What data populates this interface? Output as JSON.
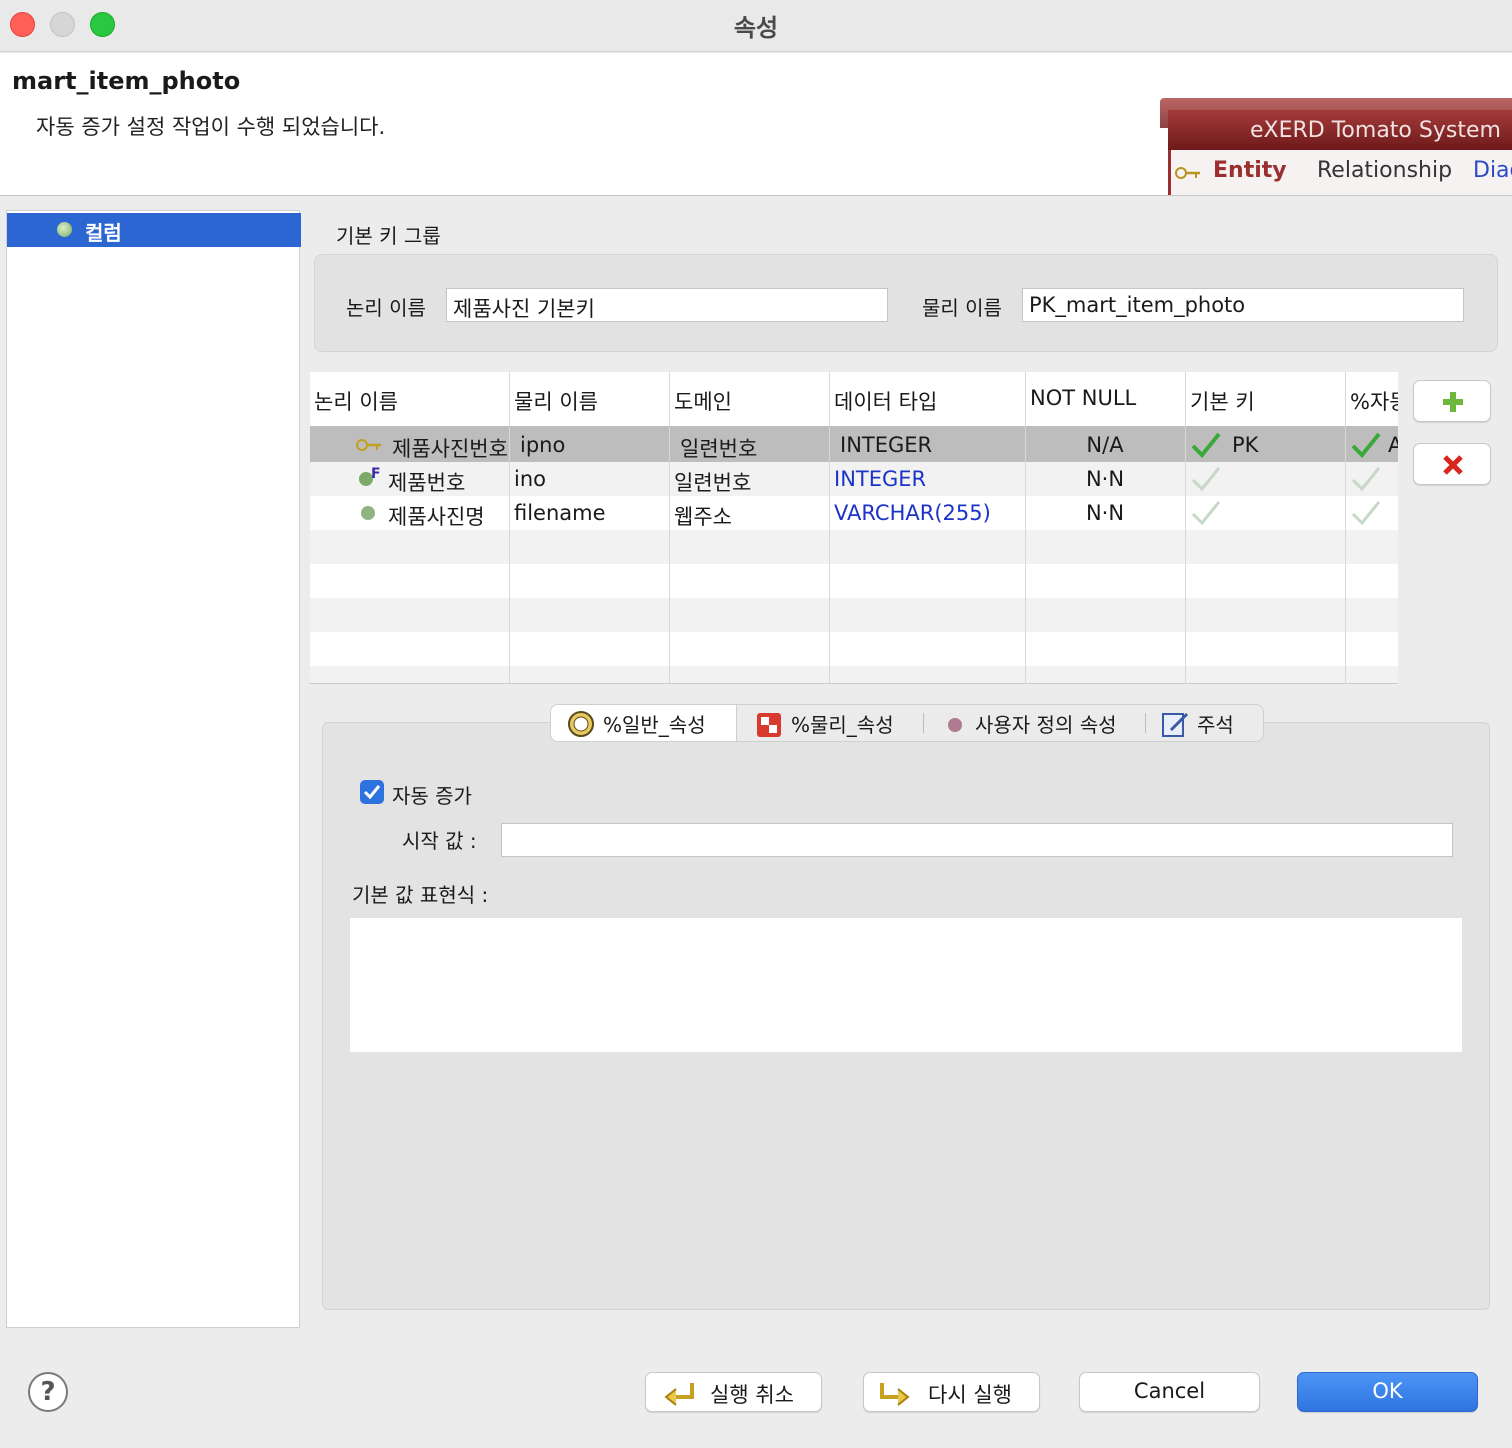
{
  "window": {
    "title": "속성"
  },
  "header": {
    "entity_name": "mart_item_photo",
    "message": "자동 증가 설정 작업이 수행 되었습니다.",
    "banner": {
      "title": "eXERD Tomato System",
      "tabs": [
        "Entity",
        "Relationship",
        "Diag"
      ]
    }
  },
  "tree": {
    "items": [
      {
        "label": "컬럼",
        "selected": true
      }
    ]
  },
  "pk_group": {
    "title": "기본 키 그룹",
    "logical_label": "논리 이름",
    "logical_value": "제품사진 기본키",
    "physical_label": "물리 이름",
    "physical_value": "PK_mart_item_photo"
  },
  "columns_table": {
    "headers": [
      "논리 이름",
      "물리 이름",
      "도메인",
      "데이터 타입",
      "NOT NULL",
      "기본 키",
      "%자동"
    ],
    "rows": [
      {
        "logical": "제품사진번호",
        "physical": "ipno",
        "domain": "일련번호",
        "type": "INTEGER",
        "not_null": "N/A",
        "pk": "PK",
        "pk_checked": true,
        "auto": "A",
        "auto_checked": true,
        "icon": "key-icon",
        "selected": true
      },
      {
        "logical": "제품번호",
        "physical": "ino",
        "domain": "일련번호",
        "type": "INTEGER",
        "not_null": "N·N",
        "pk": "",
        "pk_checked": false,
        "auto": "",
        "auto_checked": false,
        "icon": "foreign-key-column-icon",
        "selected": false
      },
      {
        "logical": "제품사진명",
        "physical": "filename",
        "domain": "웹주소",
        "type": "VARCHAR(255)",
        "not_null": "N·N",
        "pk": "",
        "pk_checked": false,
        "auto": "",
        "auto_checked": false,
        "icon": "column-icon",
        "selected": false
      }
    ]
  },
  "side_buttons": {
    "add": "add-icon",
    "remove": "remove-icon"
  },
  "tabs": [
    "%일반_속성",
    "%물리_속성",
    "사용자 정의 속성",
    "주석"
  ],
  "general": {
    "auto_increment_label": "자동 증가",
    "auto_increment_checked": true,
    "start_value_label": "시작 값 :",
    "start_value": "",
    "default_expr_label": "기본 값 표현식 :",
    "default_expr": ""
  },
  "footer": {
    "undo": "실행 취소",
    "redo": "다시 실행",
    "cancel": "Cancel",
    "ok": "OK",
    "help": "?"
  },
  "colors": {
    "accent": "#2c66d2",
    "ok_button": "#3a82ec",
    "type_text": "#1c33c8",
    "close": "#ff5f57",
    "minimize": "#d6d6d6",
    "zoom": "#29c840",
    "selected_row": "#bdbdbd"
  }
}
